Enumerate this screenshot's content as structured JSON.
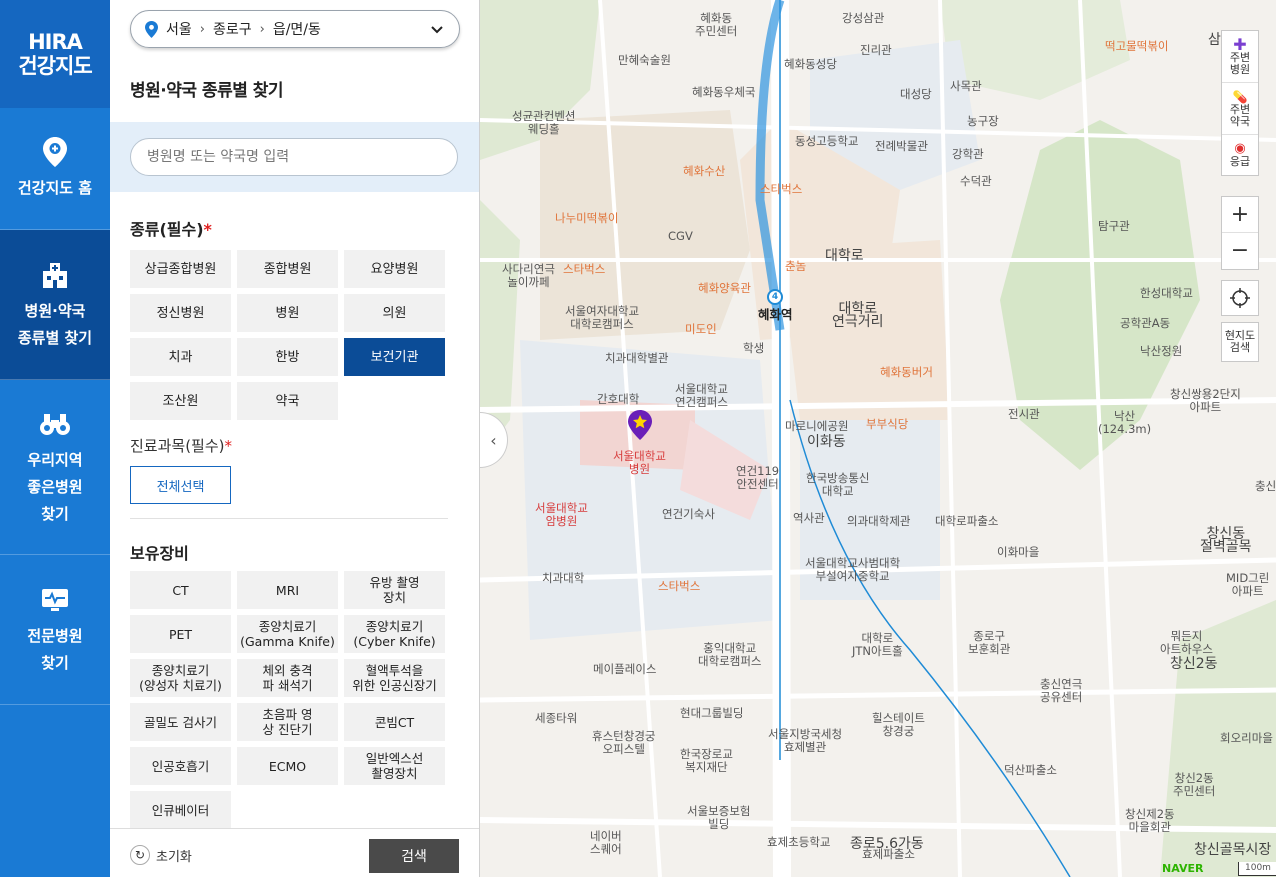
{
  "nav": {
    "logo": [
      "HIRA",
      "건강지도"
    ],
    "items": [
      {
        "label": [
          "건강지도 홈"
        ]
      },
      {
        "label": [
          "병원·약국",
          "종류별 찾기"
        ]
      },
      {
        "label": [
          "우리지역",
          "좋은병원",
          "찾기"
        ]
      },
      {
        "label": [
          "전문병원",
          "찾기"
        ]
      }
    ]
  },
  "region": {
    "city": "서울",
    "district": "종로구",
    "dong": "읍/면/동"
  },
  "panel_title": "병원·약국 종류별 찾기",
  "search": {
    "placeholder": "병원명 또는 약국명 입력"
  },
  "type_section": {
    "title": "종류(필수)",
    "required_mark": "*",
    "options": [
      "상급종합병원",
      "종합병원",
      "요양병원",
      "정신병원",
      "병원",
      "의원",
      "치과",
      "한방",
      "보건기관",
      "조산원",
      "약국"
    ],
    "selected": "보건기관"
  },
  "subject_section": {
    "title": "진료과목(필수)",
    "required_mark": "*",
    "select_all": "전체선택"
  },
  "equipment_section": {
    "title": "보유장비",
    "options": [
      [
        "CT"
      ],
      [
        "MRI"
      ],
      [
        "유방 촬영",
        "장치"
      ],
      [
        "PET"
      ],
      [
        "종양치료기",
        "(Gamma Knife)"
      ],
      [
        "종양치료기",
        "(Cyber Knife)"
      ],
      [
        "종양치료기",
        "(양성자 치료기)"
      ],
      [
        "체외 충격",
        "파 쇄석기"
      ],
      [
        "혈액투석을",
        "위한 인공신장기"
      ],
      [
        "골밀도 검사기"
      ],
      [
        "초음파 영",
        "상 진단기"
      ],
      [
        "콘빔CT"
      ],
      [
        "인공호흡기"
      ],
      [
        "ECMO"
      ],
      [
        "일반엑스선",
        "촬영장치"
      ],
      [
        "인큐베이터"
      ]
    ]
  },
  "footer": {
    "reset": "초기화",
    "search": "검색"
  },
  "map": {
    "controls": {
      "nearby_hospital": [
        "주변",
        "병원"
      ],
      "nearby_pharmacy": [
        "주변",
        "약국"
      ],
      "emergency": [
        "응급"
      ],
      "zoom_in": "+",
      "zoom_out": "−",
      "research": [
        "현지도",
        "검색"
      ]
    },
    "labels": [
      {
        "t": "강성삼관",
        "c": ""
      },
      {
        "t": "진리관",
        "c": ""
      },
      {
        "t": "떡고물떡볶이",
        "c": "orange"
      },
      {
        "t": "혜화동\n주민센터",
        "c": ""
      },
      {
        "t": "만혜숙술원",
        "c": ""
      },
      {
        "t": "혜화동성당",
        "c": ""
      },
      {
        "t": "혜화동우체국",
        "c": ""
      },
      {
        "t": "대성당",
        "c": ""
      },
      {
        "t": "사목관",
        "c": ""
      },
      {
        "t": "성균관컨벤션\n웨딩홀",
        "c": ""
      },
      {
        "t": "동성고등학교",
        "c": ""
      },
      {
        "t": "전례박물관",
        "c": ""
      },
      {
        "t": "농구장",
        "c": ""
      },
      {
        "t": "혜화수산",
        "c": "orange"
      },
      {
        "t": "강학관",
        "c": ""
      },
      {
        "t": "수덕관",
        "c": ""
      },
      {
        "t": "스타벅스",
        "c": "orange"
      },
      {
        "t": "나누미떡볶이",
        "c": "orange"
      },
      {
        "t": "CGV",
        "c": ""
      },
      {
        "t": "탐구관",
        "c": ""
      },
      {
        "t": "사다리연극\n놀이까페",
        "c": ""
      },
      {
        "t": "스타벅스",
        "c": "orange"
      },
      {
        "t": "혜화양육관",
        "c": "orange"
      },
      {
        "t": "춘놈",
        "c": "orange"
      },
      {
        "t": "대학로",
        "c": "big"
      },
      {
        "t": "한성대학교",
        "c": ""
      },
      {
        "t": "서울여자대학교\n대학로캠퍼스",
        "c": ""
      },
      {
        "t": "미도인",
        "c": "orange"
      },
      {
        "t": "혜화역",
        "c": "dark"
      },
      {
        "t": "대학로\n연극거리",
        "c": "big"
      },
      {
        "t": "공학관A동",
        "c": ""
      },
      {
        "t": "낙산정원",
        "c": ""
      },
      {
        "t": "치과대학별관",
        "c": ""
      },
      {
        "t": "학생",
        "c": ""
      },
      {
        "t": "혜화동버거",
        "c": "orange"
      },
      {
        "t": "창신쌍용2단지\n아파트",
        "c": ""
      },
      {
        "t": "간호대학",
        "c": ""
      },
      {
        "t": "서울대학교\n연건캠퍼스",
        "c": ""
      },
      {
        "t": "전시관",
        "c": ""
      },
      {
        "t": "낙산\n(124.3m)",
        "c": ""
      },
      {
        "t": "마로니에공원",
        "c": ""
      },
      {
        "t": "부부식당",
        "c": "orange"
      },
      {
        "t": "서울대학교\n병원",
        "c": "red"
      },
      {
        "t": "이화동",
        "c": "big"
      },
      {
        "t": "연건119\n안전센터",
        "c": ""
      },
      {
        "t": "한국방송통신\n대학교",
        "c": ""
      },
      {
        "t": "서울대학교\n암병원",
        "c": "red"
      },
      {
        "t": "연건기숙사",
        "c": ""
      },
      {
        "t": "역사관",
        "c": ""
      },
      {
        "t": "의과대학제관",
        "c": ""
      },
      {
        "t": "대학로파출소",
        "c": ""
      },
      {
        "t": "이화마을",
        "c": ""
      },
      {
        "t": "창신동\n절벽골목",
        "c": "big"
      },
      {
        "t": "치과대학",
        "c": ""
      },
      {
        "t": "스타벅스",
        "c": "orange"
      },
      {
        "t": "서울대학교사범대학\n부설여자중학교",
        "c": ""
      },
      {
        "t": "MID그린\n아파트",
        "c": ""
      },
      {
        "t": "대학로\nJTN아트홀",
        "c": ""
      },
      {
        "t": "종로구\n보훈회관",
        "c": ""
      },
      {
        "t": "뭐든지\n아트하우스",
        "c": ""
      },
      {
        "t": "홍익대학교\n대학로캠퍼스",
        "c": ""
      },
      {
        "t": "메이플레이스",
        "c": ""
      },
      {
        "t": "창신2동",
        "c": "big"
      },
      {
        "t": "충신연극\n공유센터",
        "c": ""
      },
      {
        "t": "세종타워",
        "c": ""
      },
      {
        "t": "현대그룹빌딩",
        "c": ""
      },
      {
        "t": "힐스테이트\n창경궁",
        "c": ""
      },
      {
        "t": "휴스턴창경궁\n오피스텔",
        "c": ""
      },
      {
        "t": "서울지방국세청\n효제별관",
        "c": ""
      },
      {
        "t": "회오리마을",
        "c": ""
      },
      {
        "t": "한국장로교\n복지재단",
        "c": ""
      },
      {
        "t": "덕산파출소",
        "c": ""
      },
      {
        "t": "창신2동\n주민센터",
        "c": ""
      },
      {
        "t": "서울보증보험\n빌딩",
        "c": ""
      },
      {
        "t": "창신제2동\n마을회관",
        "c": ""
      },
      {
        "t": "네이버\n스퀘어",
        "c": ""
      },
      {
        "t": "효제초등학교",
        "c": ""
      },
      {
        "t": "종로5.6가동",
        "c": "big"
      },
      {
        "t": "효제파출소",
        "c": ""
      },
      {
        "t": "창신골목시장",
        "c": "big"
      },
      {
        "t": "삼",
        "c": "big"
      },
      {
        "t": "충신",
        "c": ""
      },
      {
        "t": "NAVER",
        "c": ""
      },
      {
        "t": "100m",
        "c": ""
      }
    ]
  }
}
